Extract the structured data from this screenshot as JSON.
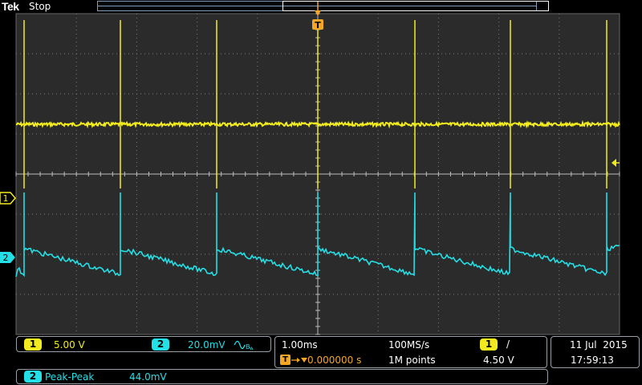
{
  "header": {
    "brand": "Tek",
    "status": "Stop"
  },
  "trigger_marker": "T",
  "channels": [
    {
      "id": "1",
      "color": "#f2ec1e",
      "scale": "5.00 V"
    },
    {
      "id": "2",
      "color": "#23dfe6",
      "scale": "20.0mV"
    }
  ],
  "timebase": {
    "time_per_div": "1.00ms",
    "trigger_position": "0.000000 s",
    "sample_rate": "100MS/s",
    "record_length": "1M points"
  },
  "trigger": {
    "source": "1",
    "slope": "/",
    "level": "4.50 V"
  },
  "datetime": {
    "date": "11 Jul  2015",
    "time": "17:59:13"
  },
  "measurement": {
    "channel": "2",
    "type": "Peak-Peak",
    "value": "44.0mV"
  }
}
